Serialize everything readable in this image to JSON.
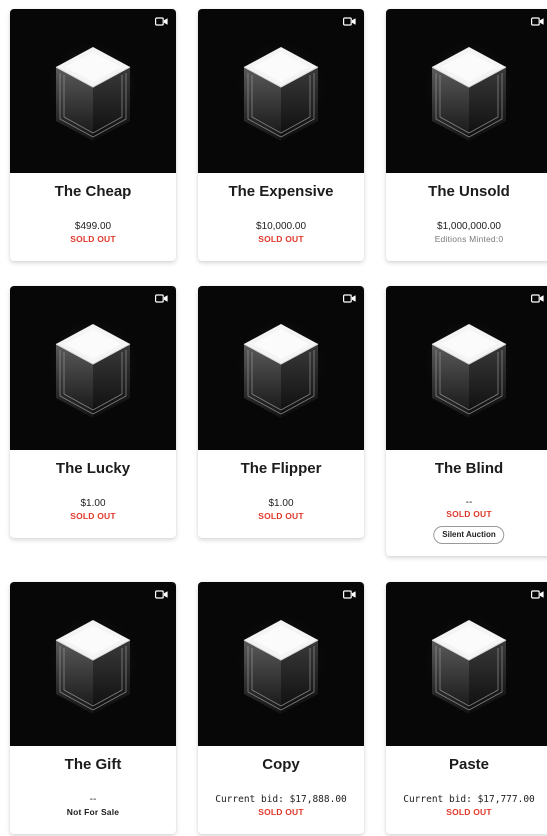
{
  "colors": {
    "sold_out": "#e0392c",
    "card_media_bg": "#070707"
  },
  "cards": [
    {
      "title": "The Cheap",
      "price": "$499.00",
      "status": "SOLD OUT",
      "status_kind": "sold",
      "media_icon": "video-camera-icon"
    },
    {
      "title": "The Expensive",
      "price": "$10,000.00",
      "status": "SOLD OUT",
      "status_kind": "sold",
      "media_icon": "video-camera-icon"
    },
    {
      "title": "The Unsold",
      "price": "$1,000,000.00",
      "status": "Editions Minted:0",
      "status_kind": "muted",
      "media_icon": "video-camera-icon"
    },
    {
      "title": "The Lucky",
      "price": "$1.00",
      "status": "SOLD OUT",
      "status_kind": "sold",
      "media_icon": "video-camera-icon"
    },
    {
      "title": "The Flipper",
      "price": "$1.00",
      "status": "SOLD OUT",
      "status_kind": "sold",
      "media_icon": "video-camera-icon"
    },
    {
      "title": "The Blind",
      "price": "--",
      "status": "SOLD OUT",
      "status_kind": "sold",
      "badge": "Silent Auction",
      "media_icon": "video-camera-icon"
    },
    {
      "title": "The Gift",
      "price": "--",
      "status": "Not For Sale",
      "status_kind": "nfs",
      "media_icon": "video-camera-icon"
    },
    {
      "title": "Copy",
      "price": "Current bid: $17,888.00",
      "status": "SOLD OUT",
      "status_kind": "sold",
      "media_icon": "video-camera-icon"
    },
    {
      "title": "Paste",
      "price": "Current bid: $17,777.00",
      "status": "SOLD OUT",
      "status_kind": "sold",
      "media_icon": "video-camera-icon"
    }
  ]
}
